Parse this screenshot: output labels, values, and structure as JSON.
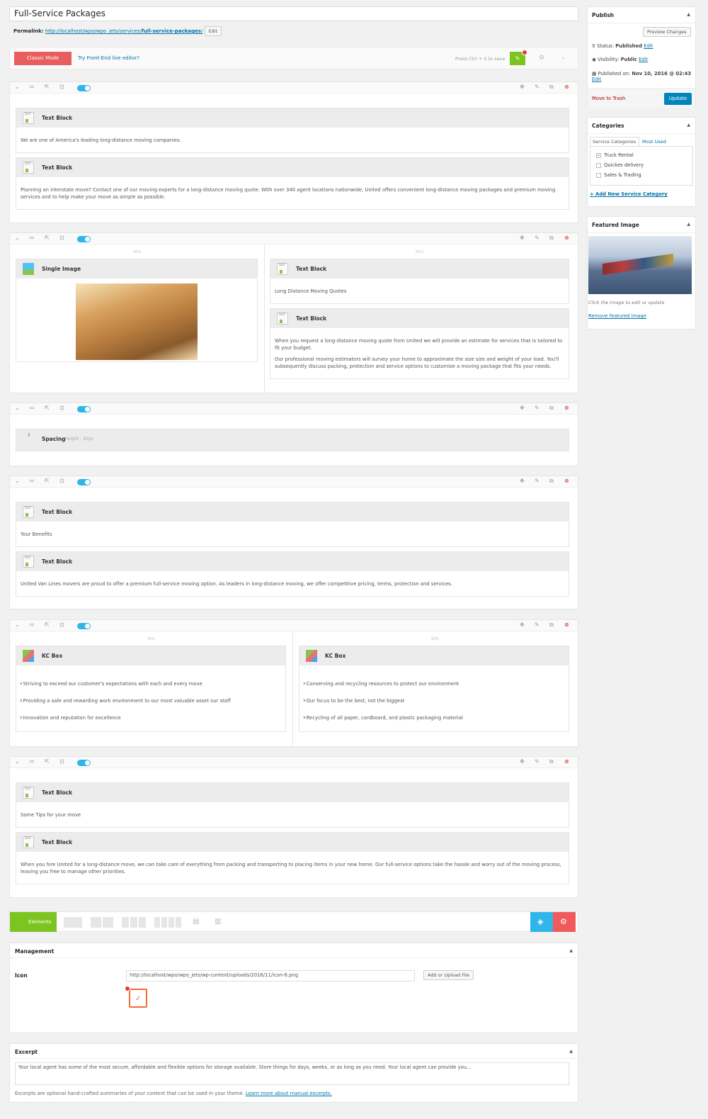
{
  "post": {
    "title": "Full-Service Packages",
    "permalink_label": "Permalink:",
    "permalink_base": "http://localhost/wpo/wpo_jets/services/",
    "permalink_slug": "full-service-packages",
    "permalink_end": "/",
    "edit_label": "Edit"
  },
  "toolbar": {
    "classic_mode": "Classic Mode",
    "front_end_link": "Try Front-End live editor?",
    "save_hint": "Press Ctrl + S to save"
  },
  "rows": [
    {
      "elements": [
        {
          "title": "Text Block",
          "text": "We are one of America's leading long-distance moving companies."
        },
        {
          "title": "Text Block",
          "text": "Planning an interstate move? Contact one of our moving experts for a long-distance moving quote. With over 340 agent locations nationwide, United offers convenient long-distance moving packages and premium moving services and to help make your move as simple as possible."
        }
      ]
    },
    {
      "col_left_pct": "45%",
      "col_right_pct": "55%",
      "image_title": "Single Image",
      "elements": [
        {
          "title": "Text Block",
          "text": "Long Distance Moving Quotes"
        },
        {
          "title": "Text Block",
          "text": "When you request a long-distance moving quote from United we will provide an estimate for services that is tailored to fit your budget.",
          "text2": "Our professional moving estimators will survey your home to approximate the size size and weight of your load. You'll subsequently discuss packing, protection and service options to customize a moving package that fits your needs."
        }
      ]
    },
    {
      "spacing_title": "Spacing",
      "spacing_meta": "height : 30px"
    },
    {
      "elements": [
        {
          "title": "Text Block",
          "text": "Your Benefits"
        },
        {
          "title": "Text Block",
          "text": "United Van Lines movers are proud to offer a premium full-service moving option. As leaders in long-distance moving, we offer competitive pricing, terms, protection and services."
        }
      ]
    },
    {
      "col_left_pct": "50%",
      "col_right_pct": "50%",
      "boxes": [
        {
          "title": "KC Box",
          "items": [
            "Striving to exceed our customer's expectations with each and every move",
            "Providing a safe and rewarding work environment to our most valuable asset our staff",
            "Innovation and reputation for excellence"
          ]
        },
        {
          "title": "KC Box",
          "items": [
            "Conserving and recycling resources to protect our environment",
            "Our focus to be the best, not the biggest",
            "Recycling of all paper, cardboard, and plastic packaging material"
          ]
        }
      ]
    },
    {
      "elements": [
        {
          "title": "Text Block",
          "text": "Some Tips for your move"
        },
        {
          "title": "Text Block",
          "text": "When you hire United for a long-distance move, we can take care of everything from packing and transporting to placing items in your new home. Our full-service options take the hassle and worry out of the moving process, leaving you free to manage other priorities."
        }
      ]
    }
  ],
  "elements_bar": {
    "label": "Elements"
  },
  "management": {
    "title": "Management",
    "icon_label": "Icon",
    "icon_url": "http://localhost/wpo/wpo_jets/wp-content/uploads/2016/11/icon-6.png",
    "upload_label": "Add or Upload File"
  },
  "excerpt": {
    "title": "Excerpt",
    "value": "Your local agent has some of the most secure, affordable and flexible options for storage available. Store things for days, weeks, or as long as you need. Your local agent can provide you...",
    "help": "Excerpts are optional hand-crafted summaries of your content that can be used in your theme.",
    "help_link": "Learn more about manual excerpts."
  },
  "publish": {
    "title": "Publish",
    "preview": "Preview Changes",
    "status_label": "Status:",
    "status_value": "Published",
    "visibility_label": "Visibility:",
    "visibility_value": "Public",
    "published_label": "Published on:",
    "published_value": "Nov 10, 2016 @ 02:43",
    "edit": "Edit",
    "trash": "Move to Trash",
    "update": "Update"
  },
  "categories": {
    "title": "Categories",
    "tab_all": "Service Categories",
    "tab_used": "Most Used",
    "items": [
      {
        "label": "Truck Rental",
        "checked": true
      },
      {
        "label": "Quickes delivery",
        "checked": false
      },
      {
        "label": "Sales & Trading",
        "checked": false
      }
    ],
    "add_new": "+ Add New Service Category"
  },
  "featured": {
    "title": "Featured Image",
    "hint": "Click the image to edit or update",
    "remove": "Remove featured image"
  }
}
